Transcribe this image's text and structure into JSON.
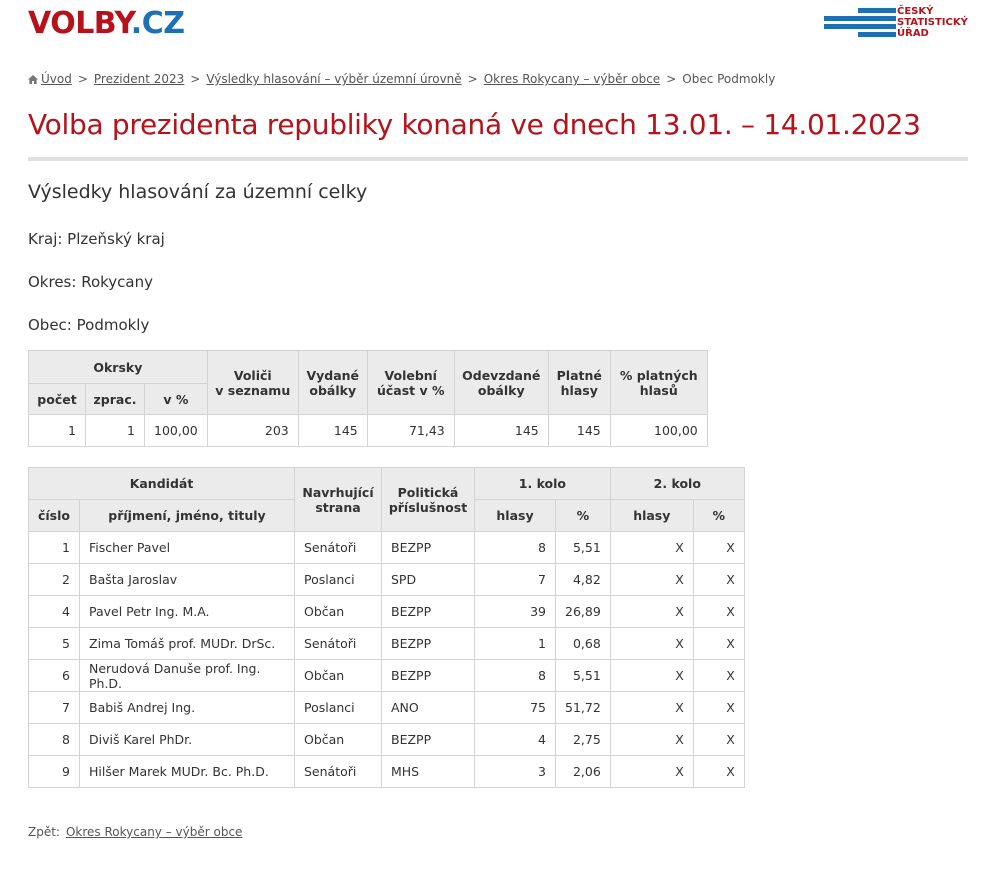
{
  "logo": {
    "part1": "VOLBY",
    "part2": ".CZ"
  },
  "csu_logo": {
    "line1": "ČESKÝ",
    "line2": "STATISTICKÝ",
    "line3": "ÚŘAD"
  },
  "breadcrumb": {
    "items": [
      {
        "label": "Úvod"
      },
      {
        "label": "Prezident 2023"
      },
      {
        "label": "Výsledky hlasování – výběr územní úrovně"
      },
      {
        "label": "Okres Rokycany – výběr obce"
      }
    ],
    "current": "Obec Podmokly",
    "separator": ">"
  },
  "page_title": "Volba prezidenta republiky konaná ve dnech 13.01. – 14.01.2023",
  "section_title": "Výsledky hlasování za územní celky",
  "info": {
    "kraj": "Kraj: Plzeňský kraj",
    "okres": "Okres: Rokycany",
    "obec": "Obec: Podmokly"
  },
  "summary": {
    "headers": {
      "okrsky": "Okrsky",
      "pocet": "počet",
      "zprac": "zprac.",
      "v_pct": "v %",
      "volici_1": "Voliči",
      "volici_2": "v seznamu",
      "vydane_1": "Vydané",
      "vydane_2": "obálky",
      "ucast_1": "Volební",
      "ucast_2": "účast v %",
      "odevzdane_1": "Odevzdané",
      "odevzdane_2": "obálky",
      "platne_1": "Platné",
      "platne_2": "hlasy",
      "pct_platnych_1": "% platných",
      "pct_platnych_2": "hlasů"
    },
    "row": {
      "pocet": "1",
      "zprac": "1",
      "v_pct": "100,00",
      "volici": "203",
      "vydane": "145",
      "ucast": "71,43",
      "odevzdane": "145",
      "platne": "145",
      "pct_platnych": "100,00"
    }
  },
  "results": {
    "headers": {
      "kandidat": "Kandidát",
      "cislo": "číslo",
      "jmeno": "příjmení, jméno, tituly",
      "navrhujici_1": "Navrhující",
      "navrhujici_2": "strana",
      "politicka_1": "Politická",
      "politicka_2": "příslušnost",
      "kolo1": "1. kolo",
      "kolo2": "2. kolo",
      "hlasy": "hlasy",
      "pct": "%"
    },
    "rows": [
      {
        "cislo": "1",
        "jmeno": "Fischer Pavel",
        "navrhujici": "Senátoři",
        "politicka": "BEZPP",
        "hlasy1": "8",
        "pct1": "5,51",
        "hlasy2": "X",
        "pct2": "X"
      },
      {
        "cislo": "2",
        "jmeno": "Bašta Jaroslav",
        "navrhujici": "Poslanci",
        "politicka": "SPD",
        "hlasy1": "7",
        "pct1": "4,82",
        "hlasy2": "X",
        "pct2": "X"
      },
      {
        "cislo": "4",
        "jmeno": "Pavel Petr Ing. M.A.",
        "navrhujici": "Občan",
        "politicka": "BEZPP",
        "hlasy1": "39",
        "pct1": "26,89",
        "hlasy2": "X",
        "pct2": "X"
      },
      {
        "cislo": "5",
        "jmeno": "Zima Tomáš prof. MUDr. DrSc.",
        "navrhujici": "Senátoři",
        "politicka": "BEZPP",
        "hlasy1": "1",
        "pct1": "0,68",
        "hlasy2": "X",
        "pct2": "X"
      },
      {
        "cislo": "6",
        "jmeno": "Nerudová Danuše prof. Ing. Ph.D.",
        "navrhujici": "Občan",
        "politicka": "BEZPP",
        "hlasy1": "8",
        "pct1": "5,51",
        "hlasy2": "X",
        "pct2": "X"
      },
      {
        "cislo": "7",
        "jmeno": "Babiš Andrej Ing.",
        "navrhujici": "Poslanci",
        "politicka": "ANO",
        "hlasy1": "75",
        "pct1": "51,72",
        "hlasy2": "X",
        "pct2": "X"
      },
      {
        "cislo": "8",
        "jmeno": "Diviš Karel PhDr.",
        "navrhujici": "Občan",
        "politicka": "BEZPP",
        "hlasy1": "4",
        "pct1": "2,75",
        "hlasy2": "X",
        "pct2": "X"
      },
      {
        "cislo": "9",
        "jmeno": "Hilšer Marek MUDr. Bc. Ph.D.",
        "navrhujici": "Senátoři",
        "politicka": "MHS",
        "hlasy1": "3",
        "pct1": "2,06",
        "hlasy2": "X",
        "pct2": "X"
      }
    ]
  },
  "back": {
    "label": "Zpět:",
    "link": "Okres Rokycany – výběr obce"
  },
  "colors": {
    "brand_red": "#b5121b",
    "brand_blue": "#1f6fb5",
    "header_bg": "#ebebeb"
  }
}
